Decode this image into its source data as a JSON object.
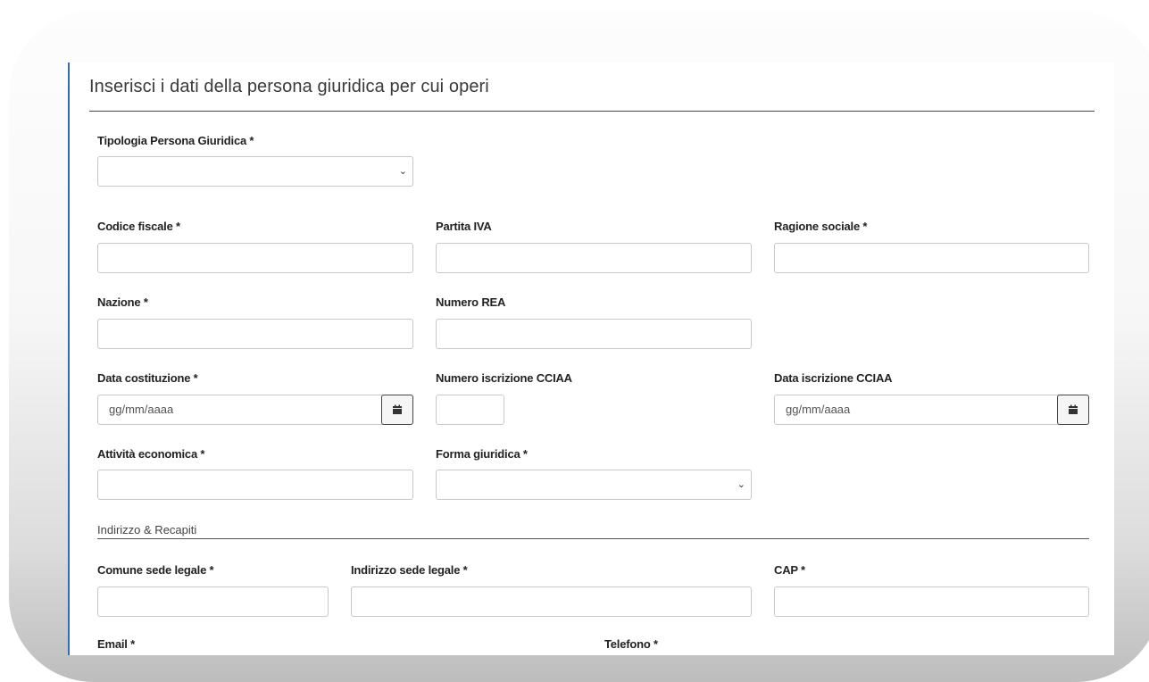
{
  "form": {
    "title": "Inserisci i dati della persona giuridica per cui operi",
    "fields": {
      "tipologia": {
        "label": "Tipologia Persona Giuridica *",
        "value": ""
      },
      "codice_fiscale": {
        "label": "Codice fiscale *",
        "value": ""
      },
      "partita_iva": {
        "label": "Partita IVA",
        "value": ""
      },
      "ragione_sociale": {
        "label": "Ragione sociale *",
        "value": ""
      },
      "nazione": {
        "label": "Nazione *",
        "value": ""
      },
      "numero_rea": {
        "label": "Numero REA",
        "value": ""
      },
      "data_costituzione": {
        "label": "Data costituzione *",
        "placeholder": "gg/mm/aaaa"
      },
      "numero_iscrizione_cciaa": {
        "label": "Numero iscrizione CCIAA",
        "value": ""
      },
      "data_iscrizione_cciaa": {
        "label": "Data iscrizione CCIAA",
        "placeholder": "gg/mm/aaaa"
      },
      "attivita_economica": {
        "label": "Attività economica *",
        "value": ""
      },
      "forma_giuridica": {
        "label": "Forma giuridica *",
        "value": ""
      }
    },
    "section_recapiti": {
      "title": "Indirizzo & Recapiti",
      "fields": {
        "comune": {
          "label": "Comune sede legale *",
          "value": ""
        },
        "indirizzo": {
          "label": "Indirizzo sede legale *",
          "value": ""
        },
        "cap": {
          "label": "CAP *",
          "value": ""
        },
        "email": {
          "label": "Email *"
        },
        "telefono": {
          "label": "Telefono *"
        }
      }
    }
  },
  "icons": {
    "select_arrow": "chevron-down-icon",
    "date_picker": "calendar-icon"
  },
  "colors": {
    "accent_border": "#2d6fb3"
  }
}
